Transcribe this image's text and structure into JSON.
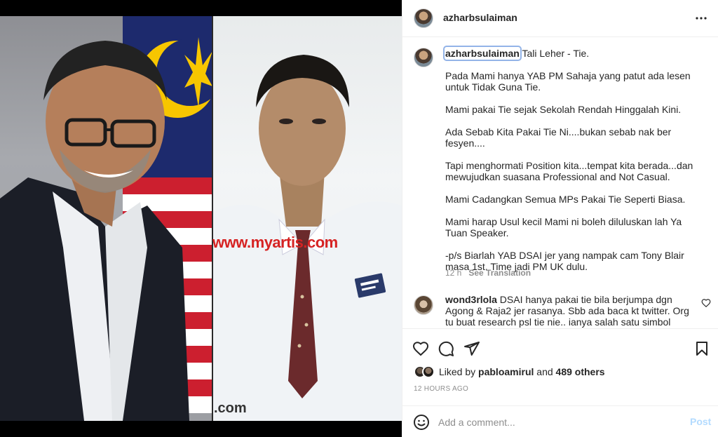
{
  "post": {
    "username": "azharbsulaiman",
    "more_icon": "more-horizontal-icon"
  },
  "media": {
    "watermark_main": "www.myartis.com",
    "watermark_bottom": ".com"
  },
  "caption": {
    "username": "azharbsulaiman",
    "title": "Tali Leher - Tie.",
    "paragraphs": [
      "Pada Mami hanya YAB PM Sahaja yang patut ada lesen untuk Tidak Guna Tie.",
      "Mami pakai Tie sejak Sekolah Rendah Hinggalah Kini.",
      "Ada Sebab Kita Pakai Tie Ni....bukan sebab nak ber fesyen....",
      "Tapi menghormati Position kita...tempat kita berada...dan mewujudkan suasana Professional and Not Casual.",
      "Mami Cadangkan Semua MPs Pakai Tie Seperti Biasa.",
      "Mami harap Usul kecil Mami ni boleh diluluskan lah Ya Tuan Speaker.",
      "-p/s Biarlah YAB DSAI jer yang nampak cam Tony Blair masa 1st. Time jadi PM UK dulu."
    ],
    "age": "12 h",
    "see_translation": "See Translation"
  },
  "comment": {
    "username": "wond3rlola",
    "text": "DSAI hanya pakai tie bila berjumpa dgn Agong & Raja2 jer rasanya. Sbb ada baca kt twitter. Org tu buat research psl tie nie.. ianya salah satu simbol pemakaian tie"
  },
  "likes": {
    "prefix": "Liked by",
    "user": "pabloamirul",
    "and": "and",
    "others": "489 others"
  },
  "timestamp": "12 HOURS AGO",
  "add_comment": {
    "placeholder": "Add a comment...",
    "post_label": "Post"
  },
  "colors": {
    "accent_post_disabled": "#b3dbff",
    "secondary_text": "#8e8e8e",
    "watermark_red": "#d62323"
  }
}
